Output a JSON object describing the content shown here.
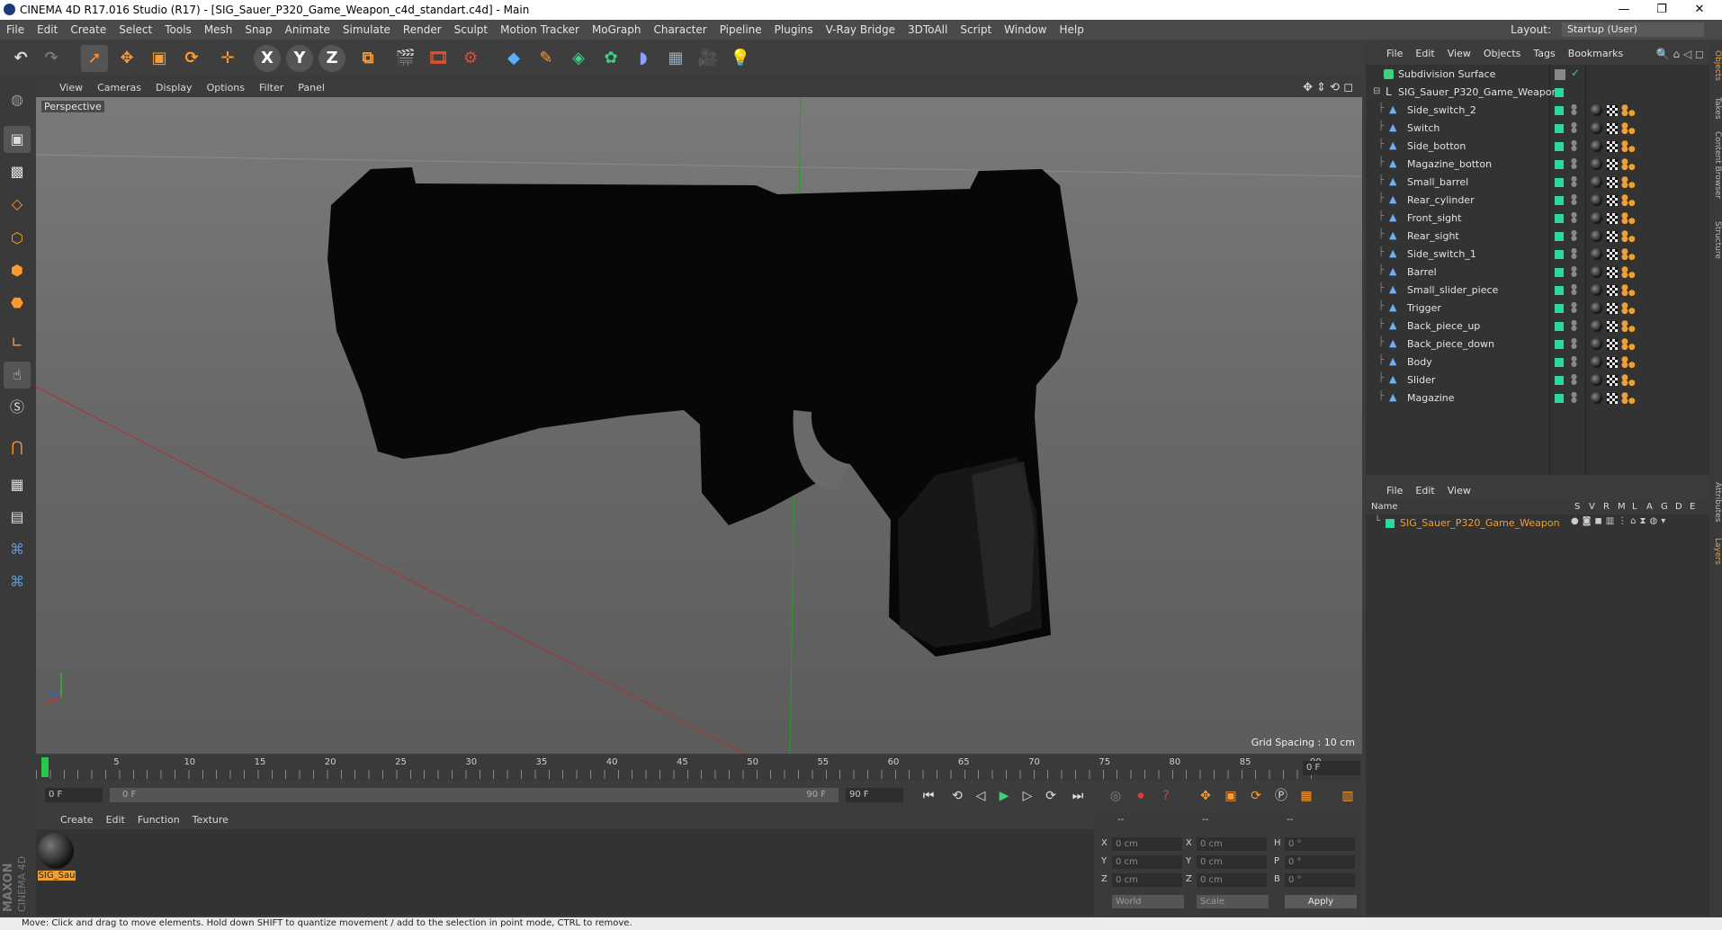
{
  "window": {
    "title": "CINEMA 4D R17.016 Studio (R17) - [SIG_Sauer_P320_Game_Weapon_c4d_standart.c4d] - Main",
    "controls": [
      "—",
      "❐",
      "✕"
    ]
  },
  "menubar": {
    "items": [
      "File",
      "Edit",
      "Create",
      "Select",
      "Tools",
      "Mesh",
      "Snap",
      "Animate",
      "Simulate",
      "Render",
      "Sculpt",
      "Motion Tracker",
      "MoGraph",
      "Character",
      "Pipeline",
      "Plugins",
      "V-Ray Bridge",
      "3DToAll",
      "Script",
      "Window",
      "Help"
    ],
    "layout_label": "Layout:",
    "layout_value": "Startup (User)"
  },
  "toolbar": {
    "axis_labels": [
      "X",
      "Y",
      "Z"
    ]
  },
  "viewport": {
    "menu": [
      "View",
      "Cameras",
      "Display",
      "Options",
      "Filter",
      "Panel"
    ],
    "camera_label": "Perspective",
    "grid_spacing": "Grid Spacing : 10 cm"
  },
  "timeline": {
    "ticks": [
      "0",
      "5",
      "10",
      "15",
      "20",
      "25",
      "30",
      "35",
      "40",
      "45",
      "50",
      "55",
      "60",
      "65",
      "70",
      "75",
      "80",
      "85",
      "90"
    ],
    "current_frame_field": "0 F",
    "start_field": "0 F",
    "slider_start": "0 F",
    "slider_end": "90 F",
    "end_field": "90 F",
    "current_frame": 0
  },
  "material_manager": {
    "menu": [
      "Create",
      "Edit",
      "Function",
      "Texture"
    ],
    "materials": [
      {
        "name": "SIG_Sau"
      }
    ],
    "brand_line1": "MAXON",
    "brand_line2": "CINEMA 4D"
  },
  "coordinates": {
    "header": [
      "--",
      "--",
      "--"
    ],
    "rows": [
      {
        "pos_label": "X",
        "pos_value": "0 cm",
        "size_label": "X",
        "size_value": "0 cm",
        "rot_label": "H",
        "rot_value": "0 °"
      },
      {
        "pos_label": "Y",
        "pos_value": "0 cm",
        "size_label": "Y",
        "size_value": "0 cm",
        "rot_label": "P",
        "rot_value": "0 °"
      },
      {
        "pos_label": "Z",
        "pos_value": "0 cm",
        "size_label": "Z",
        "size_value": "0 cm",
        "rot_label": "B",
        "rot_value": "0 °"
      }
    ],
    "space_select": "World",
    "mode_select": "Scale",
    "apply_label": "Apply"
  },
  "object_manager": {
    "menu": [
      "File",
      "Edit",
      "View",
      "Objects",
      "Tags",
      "Bookmarks"
    ],
    "top_objects": [
      {
        "name": "Subdivision Surface"
      },
      {
        "name": "SIG_Sauer_P320_Game_Weapon"
      }
    ],
    "children": [
      "Side_switch_2",
      "Switch",
      "Side_botton",
      "Magazine_botton",
      "Small_barrel",
      "Rear_cylinder",
      "Front_sight",
      "Rear_sight",
      "Side_switch_1",
      "Barrel",
      "Small_slider_piece",
      "Trigger",
      "Back_piece_up",
      "Back_piece_down",
      "Body",
      "Slider",
      "Magazine"
    ]
  },
  "layer_manager": {
    "menu": [
      "File",
      "Edit",
      "View"
    ],
    "name_header": "Name",
    "columns": [
      "S",
      "V",
      "R",
      "M",
      "L",
      "A",
      "G",
      "D",
      "E"
    ],
    "layers": [
      {
        "name": "SIG_Sauer_P320_Game_Weapon"
      }
    ]
  },
  "side_tabs": [
    "Objects",
    "Takes",
    "Content Browser",
    "Structure",
    "Attributes",
    "Layers"
  ],
  "statusbar": {
    "text": "Move: Click and drag to move elements. Hold down SHIFT to quantize movement / add to the selection in point mode, CTRL to remove."
  },
  "colors": {
    "accent_green": "#2fd6a0",
    "highlight_orange": "#f0a030",
    "x_axis": "#b03030",
    "y_axis": "#2a9a2a"
  }
}
